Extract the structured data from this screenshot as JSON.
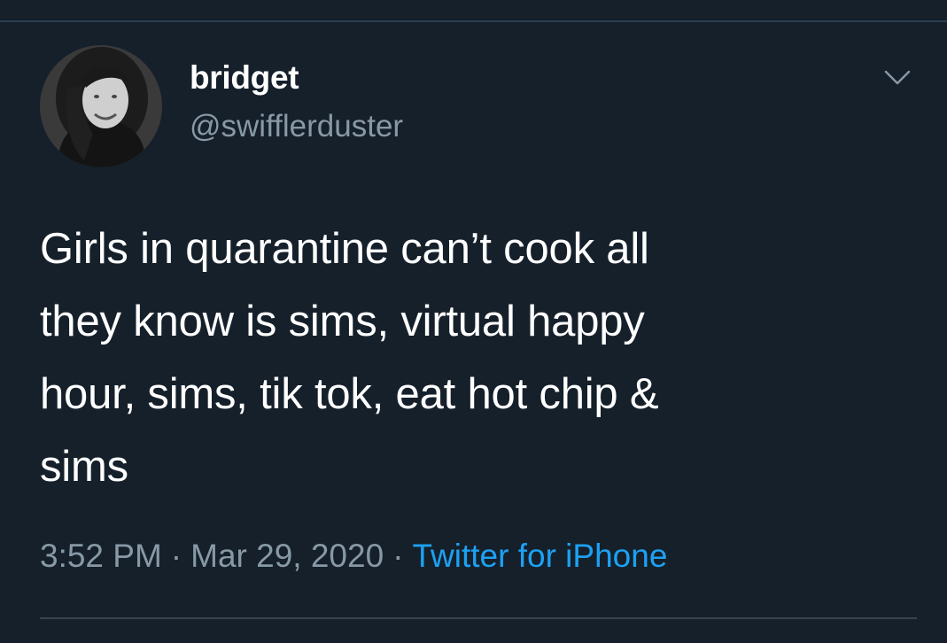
{
  "tweet": {
    "author": {
      "display_name": "bridget",
      "handle": "@swifflerduster"
    },
    "text": "Girls in quarantine can’t cook all\nthey know is sims, virtual happy\nhour, sims, tik tok, eat hot chip &\nsims",
    "time": "3:52 PM",
    "separator": "·",
    "date": "Mar 29, 2020",
    "source": "Twitter for iPhone"
  },
  "icons": {
    "menu": "chevron-down-icon",
    "avatar": "profile-photo"
  },
  "colors": {
    "background": "#15202b",
    "primary_text": "#ffffff",
    "secondary_text": "#8899a6",
    "link": "#1da1f2",
    "divider": "#38444d"
  }
}
